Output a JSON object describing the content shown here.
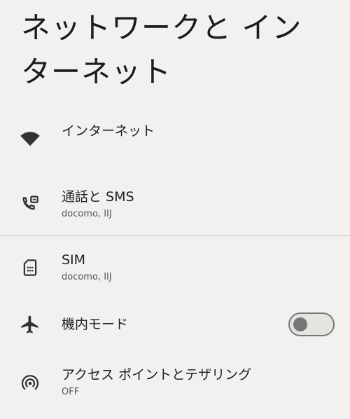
{
  "header": {
    "title": "ネットワークと インターネット"
  },
  "items": [
    {
      "icon": "wifi-icon",
      "title": "インターネット",
      "summary": ""
    },
    {
      "icon": "phone-sim-icon",
      "title": "通話と SMS",
      "summary": "docomo, IIJ"
    },
    {
      "icon": "sim-card-icon",
      "title": "SIM",
      "summary": "docomo, IIJ"
    },
    {
      "icon": "airplane-icon",
      "title": "機内モード",
      "summary": "",
      "toggle": {
        "on": false
      }
    },
    {
      "icon": "hotspot-icon",
      "title": "アクセス ポイントとテザリング",
      "summary": "OFF"
    }
  ],
  "colors": {
    "background": "#f2f1ef",
    "text": "#1f1f1f",
    "icon": "#333333",
    "toggle_off": "#777777"
  }
}
